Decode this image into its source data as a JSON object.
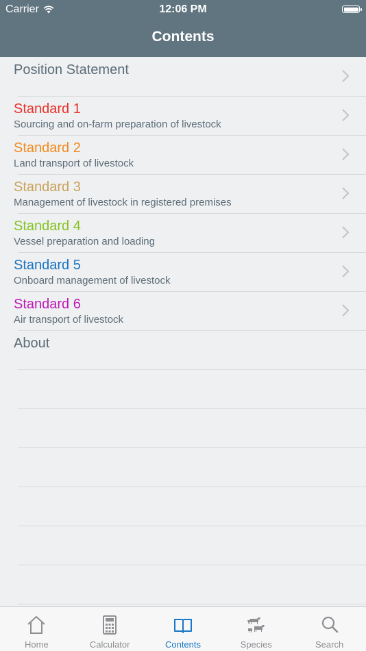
{
  "status_bar": {
    "carrier": "Carrier",
    "time": "12:06 PM"
  },
  "nav": {
    "title": "Contents"
  },
  "items": [
    {
      "title": "Position Statement",
      "subtitle": "",
      "color": "#5c6d78"
    },
    {
      "title": "Standard 1",
      "subtitle": "Sourcing and on-farm preparation of livestock",
      "color": "#e8322a"
    },
    {
      "title": "Standard 2",
      "subtitle": "Land transport of livestock",
      "color": "#f28a1e"
    },
    {
      "title": "Standard 3",
      "subtitle": "Management of livestock in registered premises",
      "color": "#c9a25a"
    },
    {
      "title": "Standard 4",
      "subtitle": "Vessel preparation and loading",
      "color": "#84c321"
    },
    {
      "title": "Standard 5",
      "subtitle": "Onboard management of livestock",
      "color": "#1a73c2"
    },
    {
      "title": "Standard 6",
      "subtitle": "Air transport of livestock",
      "color": "#bf18b6"
    },
    {
      "title": "About",
      "subtitle": "",
      "color": "#5c6d78"
    }
  ],
  "tabs": [
    {
      "label": "Home",
      "icon": "home-icon"
    },
    {
      "label": "Calculator",
      "icon": "calculator-icon"
    },
    {
      "label": "Contents",
      "icon": "book-icon",
      "active": true
    },
    {
      "label": "Species",
      "icon": "livestock-icon"
    },
    {
      "label": "Search",
      "icon": "search-icon"
    }
  ],
  "colors": {
    "header": "#617581",
    "active_tab": "#1877c6",
    "inactive_tab": "#8d8f92"
  }
}
